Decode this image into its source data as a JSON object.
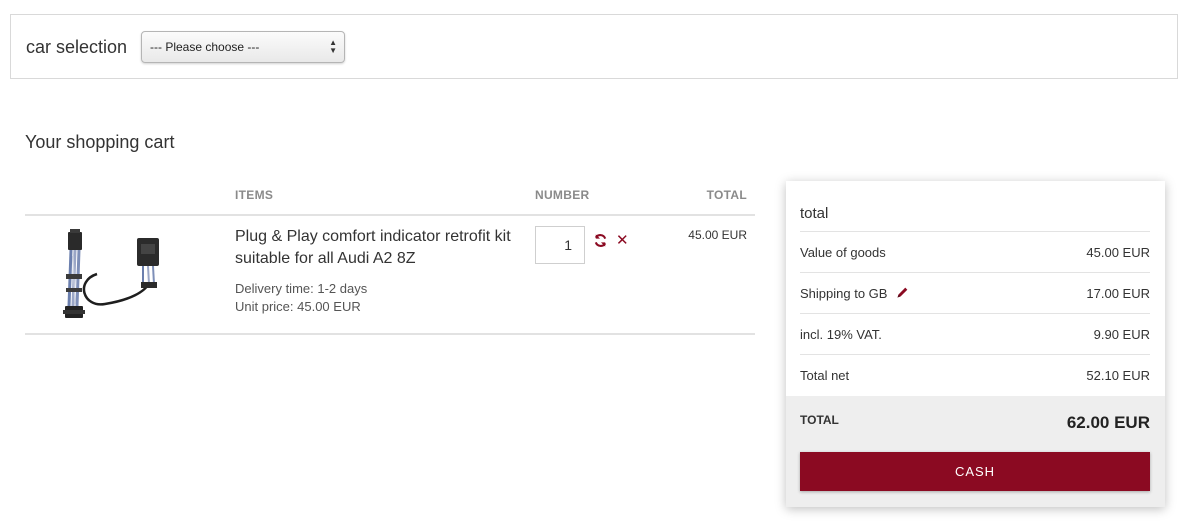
{
  "car_selection": {
    "label": "car selection",
    "select_value": "--- Please choose ---"
  },
  "cart": {
    "title": "Your shopping cart",
    "columns": {
      "items": "ITEMS",
      "number": "NUMBER",
      "total": "TOTAL"
    },
    "items": [
      {
        "name": "Plug & Play comfort indicator retrofit kit suitable for all Audi A2 8Z",
        "delivery": "Delivery time: 1-2 days",
        "unit_price": "Unit price: 45.00 EUR",
        "quantity": "1",
        "total": "45.00 EUR",
        "image": "wiring-harness-image"
      }
    ]
  },
  "summary": {
    "title": "total",
    "rows": [
      {
        "label": "Value of goods",
        "value": "45.00 EUR"
      },
      {
        "label": "Shipping to GB",
        "value": "17.00 EUR"
      },
      {
        "label": "incl. 19% VAT.",
        "value": "9.90 EUR"
      },
      {
        "label": "Total net",
        "value": "52.10 EUR"
      }
    ],
    "total_label": "TOTAL",
    "total_value": "62.00 EUR",
    "checkout_label": "CASH"
  },
  "colors": {
    "accent": "#8b0a22",
    "divider": "#e2e2e2",
    "total_band": "#eeeeee"
  },
  "icons": {
    "refresh": "refresh-icon",
    "remove": "remove-icon",
    "edit_shipping": "pencil-icon",
    "select_arrows": "chevron-updown-icon"
  }
}
